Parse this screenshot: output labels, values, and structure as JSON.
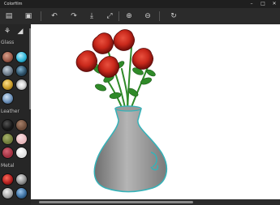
{
  "window": {
    "title": "Colorfilm",
    "controls": [
      "minimize-icon",
      "maximize-icon",
      "close-icon"
    ]
  },
  "toolbar": {
    "buttons": [
      "save-icon",
      "image-icon",
      "undo-icon",
      "redo-icon",
      "download-icon",
      "fullscreen-icon",
      "zoom-in-icon",
      "zoom-out-icon",
      "refresh-icon"
    ]
  },
  "sidebar": {
    "tool_icons": [
      "palette-icon",
      "fill-icon"
    ],
    "sections": [
      {
        "label": "Glass",
        "swatches": [
          "#9c5b4a",
          "#2fb6d8",
          "#6c7a88",
          "#2c4f66",
          "#c99b29",
          "#d8d8d8",
          "#6b8fb8"
        ]
      },
      {
        "label": "Leather",
        "swatches": [
          "#171717",
          "#6d4c3a",
          "#6f7a3a",
          "#e7b9bd",
          "#a03040",
          "#e0e0e0"
        ]
      },
      {
        "label": "Metal",
        "swatches": [
          "#b12020",
          "#8e8e8e",
          "#a8a8a8",
          "#3c6fa0"
        ]
      }
    ]
  },
  "colors": {
    "rose_red": "#c9281b",
    "rose_dark": "#6d0d0a",
    "leaf_green": "#2f8a28",
    "vase_gray": "#8f8f8f",
    "vase_outline": "#35b2b8",
    "canvas_bg": "#ffffff"
  }
}
